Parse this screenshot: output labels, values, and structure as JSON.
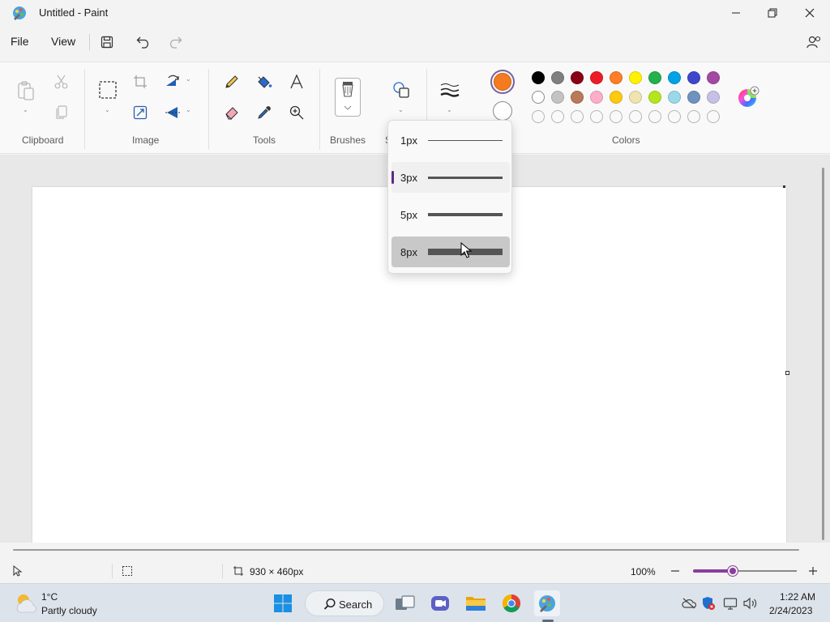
{
  "window": {
    "title": "Untitled - Paint"
  },
  "menu": {
    "file": "File",
    "view": "View"
  },
  "ribbon": {
    "groups": {
      "clipboard": "Clipboard",
      "image": "Image",
      "tools": "Tools",
      "brushes": "Brushes",
      "shapes_partial": "S",
      "colors": "Colors"
    }
  },
  "colors": {
    "primary": "#f47b20",
    "secondary": "#ffffff",
    "palette_row1": [
      "#000000",
      "#7f7f7f",
      "#880015",
      "#ed1c24",
      "#ff7f27",
      "#fff200",
      "#22b14c",
      "#00a2e8",
      "#3f48cc",
      "#a349a4"
    ],
    "palette_row2": [
      "#ffffff",
      "#c3c3c3",
      "#b97a57",
      "#ffaec9",
      "#ffc90e",
      "#efe4b0",
      "#b5e61d",
      "#99d9ea",
      "#7092be",
      "#c8bfe7"
    ],
    "accent": "#8a3d9e"
  },
  "size_menu": {
    "options": [
      {
        "label": "1px",
        "state": "normal"
      },
      {
        "label": "3px",
        "state": "selected"
      },
      {
        "label": "5px",
        "state": "normal"
      },
      {
        "label": "8px",
        "state": "hover"
      }
    ]
  },
  "status": {
    "canvas_size": "930 × 460px",
    "zoom": "100%",
    "zoom_percent": 100
  },
  "taskbar": {
    "weather_temp": "1°C",
    "weather_desc": "Partly cloudy",
    "search": "Search",
    "time": "1:22 AM",
    "date": "2/24/2023"
  }
}
